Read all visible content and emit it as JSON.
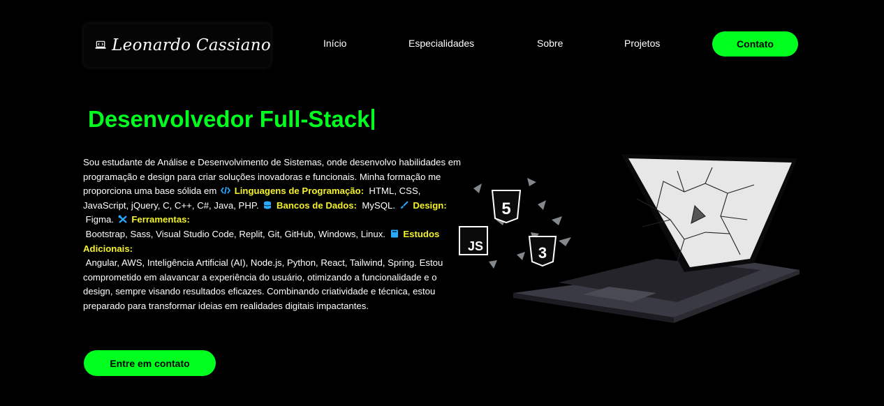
{
  "header": {
    "logo_text": "Leonardo Cassiano",
    "nav": [
      "Início",
      "Especialidades",
      "Sobre",
      "Projetos"
    ],
    "contact_button": "Contato"
  },
  "hero": {
    "title": "Desenvolvedor Full-Stack",
    "intro": "Sou estudante de Análise e Desenvolvimento de Sistemas, onde desenvolvo habilidades em programação e design para criar soluções inovadoras e funcionais. Minha formação me proporciona uma base sólida em",
    "lang_label": "Linguagens de Programação:",
    "lang_value": "HTML, CSS, JavaScript, jQuery, C, C++, C#, Java, PHP.",
    "db_label": "Bancos de Dados:",
    "db_value": "MySQL.",
    "design_label": "Design:",
    "design_value": "Figma.",
    "tools_label": "Ferramentas:",
    "tools_value": "Bootstrap, Sass, Visual Studio Code, Replit, Git, GitHub, Windows, Linux.",
    "studies_label": "Estudos Adicionais:",
    "studies_value": "Angular, AWS, Inteligência Artificial (AI), Node.js, Python, React, Tailwind, Spring.",
    "closing": "Estou comprometido em alavancar a experiência do usuário, otimizando a funcionalidade e o design, sempre visando resultados eficazes. Combinando criatividade e técnica, estou preparado para transformar ideias em realidades digitais impactantes.",
    "cta_button": "Entre em contato"
  },
  "art": {
    "html_badge": "5",
    "js_badge": "JS",
    "css_badge": "3"
  },
  "colors": {
    "accent": "#00ff1e",
    "highlight": "#f4f12a",
    "icon_blue": "#2aa8ff",
    "background": "#000000"
  },
  "icons": [
    "code-icon",
    "database-icon",
    "brush-icon",
    "tools-icon",
    "book-icon",
    "laptop-code-icon"
  ]
}
